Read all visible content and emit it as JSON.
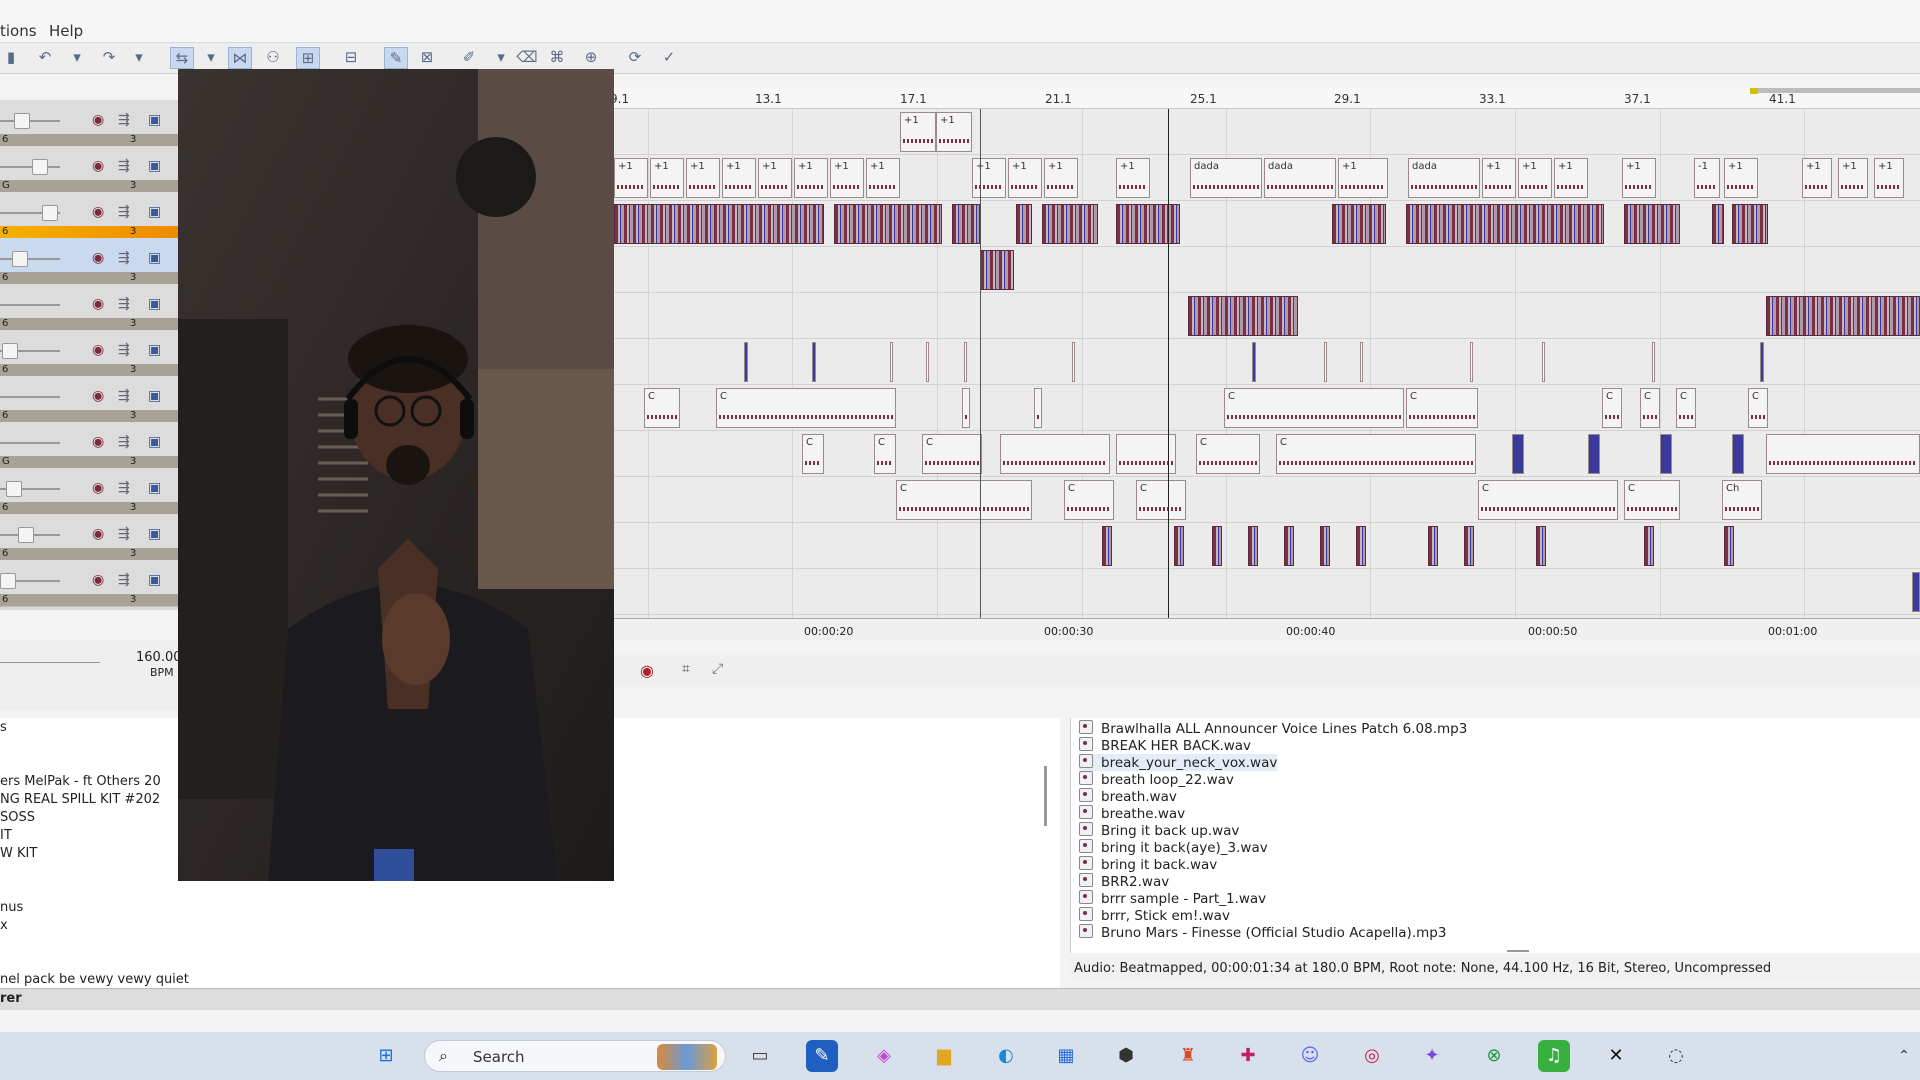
{
  "menubar": {
    "items": [
      "tions",
      "Help"
    ]
  },
  "ruler": {
    "labels": [
      "9.1",
      "13.1",
      "17.1",
      "21.1",
      "25.1",
      "29.1",
      "33.1",
      "37.1",
      "41.1"
    ]
  },
  "timecodes": [
    "00:00:20",
    "00:00:30",
    "00:00:40",
    "00:00:50",
    "00:01:00"
  ],
  "bpm": {
    "value": "160.00",
    "unit": "BPM"
  },
  "tracks": [
    {
      "left": "6",
      "right": "3",
      "highlight": false
    },
    {
      "left": "G",
      "right": "3",
      "highlight": false
    },
    {
      "left": "6",
      "right": "3",
      "highlight": true
    },
    {
      "left": "6",
      "right": "3",
      "highlight": false
    },
    {
      "left": "6",
      "right": "3",
      "highlight": false
    },
    {
      "left": "6",
      "right": "3",
      "highlight": false
    },
    {
      "left": "6",
      "right": "3",
      "highlight": false
    },
    {
      "left": "G",
      "right": "3",
      "highlight": false
    },
    {
      "left": "6",
      "right": "3",
      "highlight": false
    },
    {
      "left": "6",
      "right": "3",
      "highlight": false
    },
    {
      "left": "6",
      "right": "3",
      "highlight": false
    }
  ],
  "explorer_tree": [
    "s",
    "ers MelPak - ft Others 20",
    "NG REAL SPILL KIT #202",
    "SOSS",
    "IT",
    "W KIT",
    "nus",
    "x",
    "nel pack be vewy vewy quiet"
  ],
  "files": [
    "Brawlhalla ALL Announcer Voice Lines Patch 6.08.mp3",
    "BREAK HER BACK.wav",
    "break_your_neck_vox.wav",
    "breath loop_22.wav",
    "breath.wav",
    "breathe.wav",
    "Bring it back up.wav",
    "bring it back(aye)_3.wav",
    "bring it back.wav",
    "BRR2.wav",
    "brrr sample - Part_1.wav",
    "brrr, Stick em!.wav",
    "Bruno Mars - Finesse (Official Studio Acapella).mp3"
  ],
  "status": "Audio: Beatmapped, 00:00:01:34 at 180.0 BPM, Root note: None, 44.100 Hz, 16 Bit, Stereo, Uncompressed",
  "bottom_tab": "rer",
  "taskbar": {
    "search_label": "Search"
  },
  "clip_labels": {
    "plus": "+1",
    "dada": "dada",
    "c": "C",
    "minus": "-1",
    "ch": "Ch"
  },
  "colors": {
    "clip_dark": "#7a2f45",
    "track_strip": "#a9a297",
    "highlight": "#f5b100",
    "taskbar": "#d8e0ec"
  }
}
